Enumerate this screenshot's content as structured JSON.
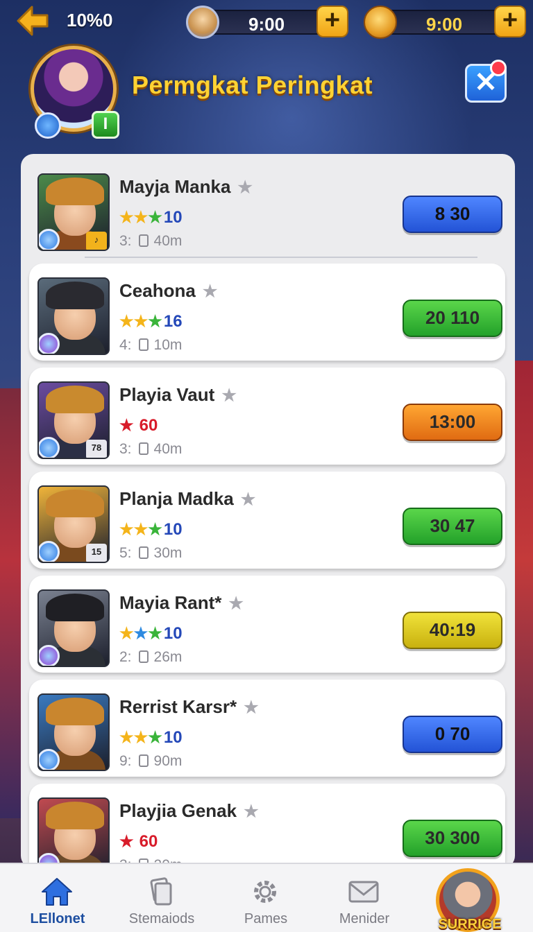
{
  "topbar": {
    "percent": "10%0",
    "resource_1": {
      "icon": "hero-crest-icon",
      "value": "9:00",
      "add_label": "+"
    },
    "resource_2": {
      "icon": "gold-leaf-icon",
      "value": "9:00",
      "add_label": "+"
    }
  },
  "header": {
    "title": "Permgkat Peringkat",
    "badge_label": "I",
    "close_label": "✕"
  },
  "players": [
    {
      "name": "Mayja Manka",
      "stars": [
        "gold",
        "gold",
        "green"
      ],
      "level": "10",
      "meta_prefix": "3:",
      "meta_time": "40m",
      "score": "8 30",
      "score_color": "blue",
      "tag": "♪"
    },
    {
      "name": "Ceahona",
      "stars": [
        "gold",
        "gold",
        "green"
      ],
      "level": "16",
      "meta_prefix": "4:",
      "meta_time": "10m",
      "score": "20 110",
      "score_color": "green",
      "tag": ""
    },
    {
      "name": "Playia Vaut",
      "stars": [
        "red"
      ],
      "level": "60",
      "meta_prefix": "3:",
      "meta_time": "40m",
      "score": "13:00",
      "score_color": "orange",
      "tag": "78"
    },
    {
      "name": "Planja Madka",
      "stars": [
        "gold",
        "gold",
        "green"
      ],
      "level": "10",
      "meta_prefix": "5:",
      "meta_time": "30m",
      "score": "30 47",
      "score_color": "green",
      "tag": "15"
    },
    {
      "name": "Mayia Rant*",
      "stars": [
        "gold",
        "blue",
        "green"
      ],
      "level": "10",
      "meta_prefix": "2:",
      "meta_time": "26m",
      "score": "40:19",
      "score_color": "yellow",
      "tag": ""
    },
    {
      "name": "Rerrist Karsr*",
      "stars": [
        "gold",
        "gold",
        "green"
      ],
      "level": "10",
      "meta_prefix": "9:",
      "meta_time": "90m",
      "score": "0 70",
      "score_color": "blue",
      "tag": ""
    },
    {
      "name": "Playjia Genak",
      "stars": [
        "red"
      ],
      "level": "60",
      "meta_prefix": "3:",
      "meta_time": "20m",
      "score": "30 300",
      "score_color": "green",
      "tag": ""
    }
  ],
  "bottom_nav": [
    {
      "label": "LEllonet",
      "icon": "home-icon",
      "active": true
    },
    {
      "label": "Stemaiods",
      "icon": "cards-icon",
      "active": false
    },
    {
      "label": "Pames",
      "icon": "gear-icon",
      "active": false
    },
    {
      "label": "Menider",
      "icon": "mail-icon",
      "active": false
    }
  ],
  "cta_label": "SURRIGE",
  "colors": {
    "title": "#ffd233",
    "score_blue": "#2f63e6",
    "score_green": "#2eb02e",
    "score_orange": "#f08420",
    "score_yellow": "#dccb1e",
    "level_blue": "#2448b8",
    "level_red": "#d81c2a"
  }
}
